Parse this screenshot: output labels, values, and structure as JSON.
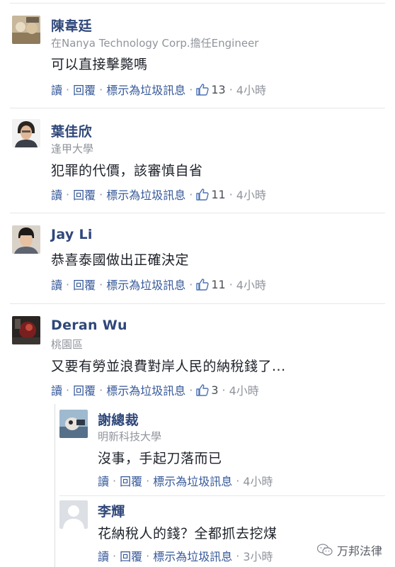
{
  "comments": [
    {
      "name": "陳韋廷",
      "subtitle": "在Nanya Technology Corp.擔任Engineer",
      "text": "可以直接擊斃嗎",
      "actions": {
        "read": "讀",
        "reply": "回覆",
        "spam": "標示為垃圾訊息",
        "likes": "13",
        "time": "4小時"
      }
    },
    {
      "name": "葉佳欣",
      "subtitle": "逢甲大學",
      "text": "犯罪的代價，該審慎自省",
      "actions": {
        "read": "讀",
        "reply": "回覆",
        "spam": "標示為垃圾訊息",
        "likes": "11",
        "time": "4小時"
      }
    },
    {
      "name": "Jay Li",
      "subtitle": "",
      "text": "恭喜泰國做出正確決定",
      "actions": {
        "read": "讀",
        "reply": "回覆",
        "spam": "標示為垃圾訊息",
        "likes": "11",
        "time": "4小時"
      }
    },
    {
      "name": "Deran Wu",
      "subtitle": "桃園區",
      "text": "又要有勞並浪費對岸人民的納稅錢了...",
      "actions": {
        "read": "讀",
        "reply": "回覆",
        "spam": "標示為垃圾訊息",
        "likes": "3",
        "time": "4小時"
      }
    }
  ],
  "replies": [
    {
      "name": "謝總裁",
      "subtitle": "明新科技大學",
      "text": "沒事，手起刀落而已",
      "actions": {
        "read": "讀",
        "reply": "回覆",
        "spam": "標示為垃圾訊息",
        "time": "4小時"
      }
    },
    {
      "name": "李輝",
      "subtitle": "",
      "text": "花納稅人的錢？全都抓去挖煤",
      "actions": {
        "read": "讀",
        "reply": "回覆",
        "spam": "標示為垃圾訊息",
        "time": "3小時"
      }
    }
  ],
  "watermark": {
    "label": "万邦法律",
    "icon": "wechat-icon"
  },
  "colors": {
    "name": "#2f477a",
    "link": "#365899",
    "meta": "#90949c",
    "text": "#1d2129"
  }
}
